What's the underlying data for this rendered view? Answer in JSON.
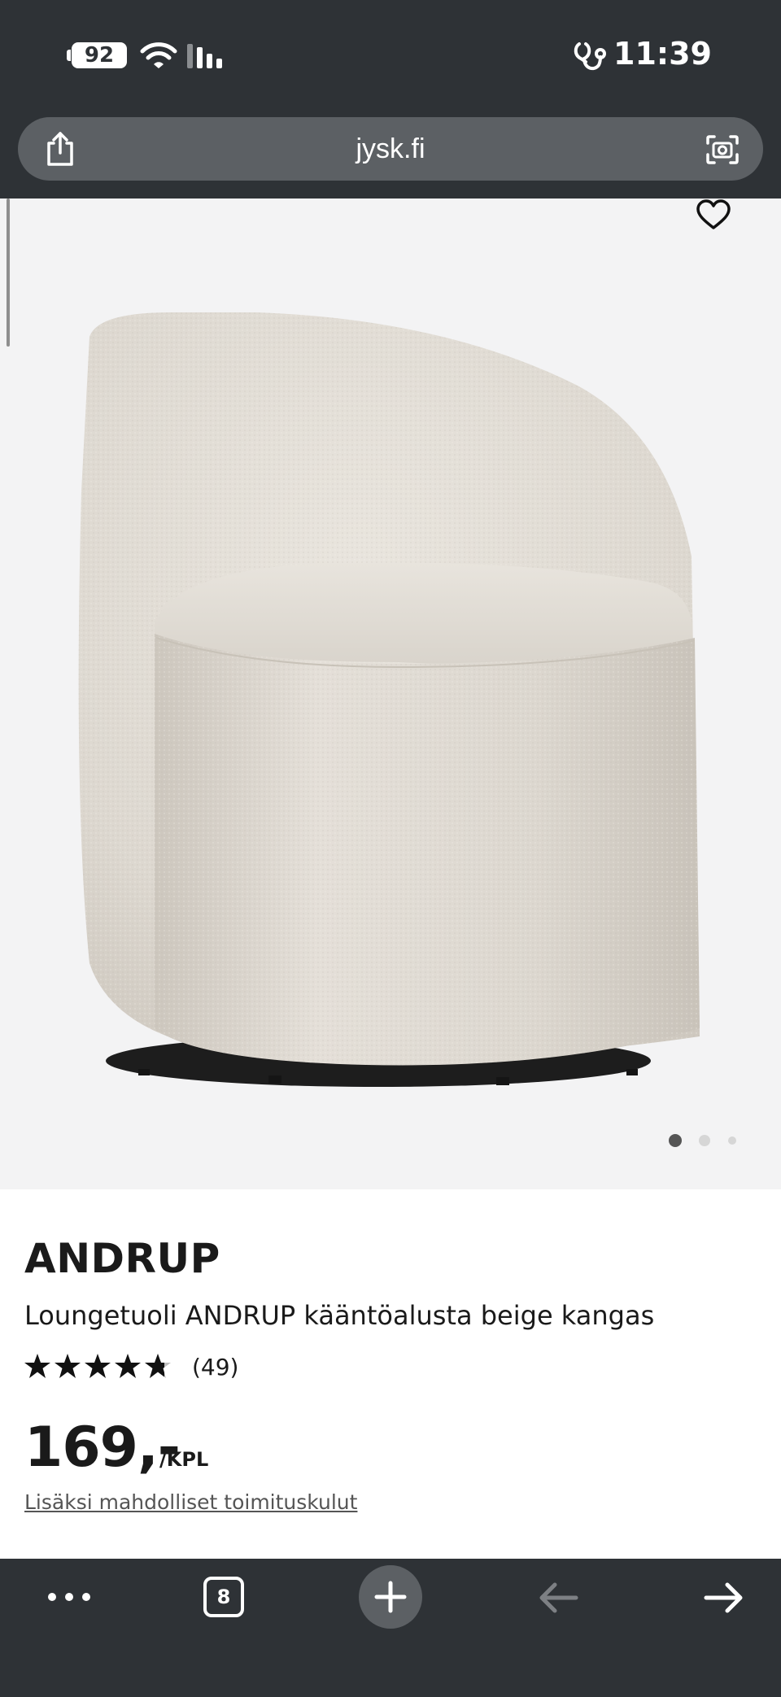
{
  "status_bar": {
    "battery": "92",
    "time": "11:39"
  },
  "browser": {
    "url": "jysk.fi",
    "tab_count": "8"
  },
  "gallery": {
    "image_alt": "Loungetuoli ANDRUP kääntöalusta beige kangas",
    "slide_count": 3,
    "active_slide": 1
  },
  "product": {
    "brand": "ANDRUP",
    "name": "Loungetuoli ANDRUP kääntöalusta beige kangas",
    "rating": 4.8,
    "review_count": "(49)",
    "price": "169,-",
    "price_unit": "/KPL",
    "shipping_note": "Lisäksi mahdolliset toimituskulut"
  },
  "colors": {
    "chrome": "#2e3236",
    "pill": "#5c6064",
    "image_bg": "#f3f3f4",
    "text": "#1a1a1a"
  },
  "icons": [
    "share-icon",
    "camera-lens-icon",
    "heart-icon",
    "more-icon",
    "tabs-icon",
    "plus-icon",
    "back-arrow-icon",
    "forward-arrow-icon",
    "wifi-icon",
    "signal-icon",
    "health-icon"
  ]
}
